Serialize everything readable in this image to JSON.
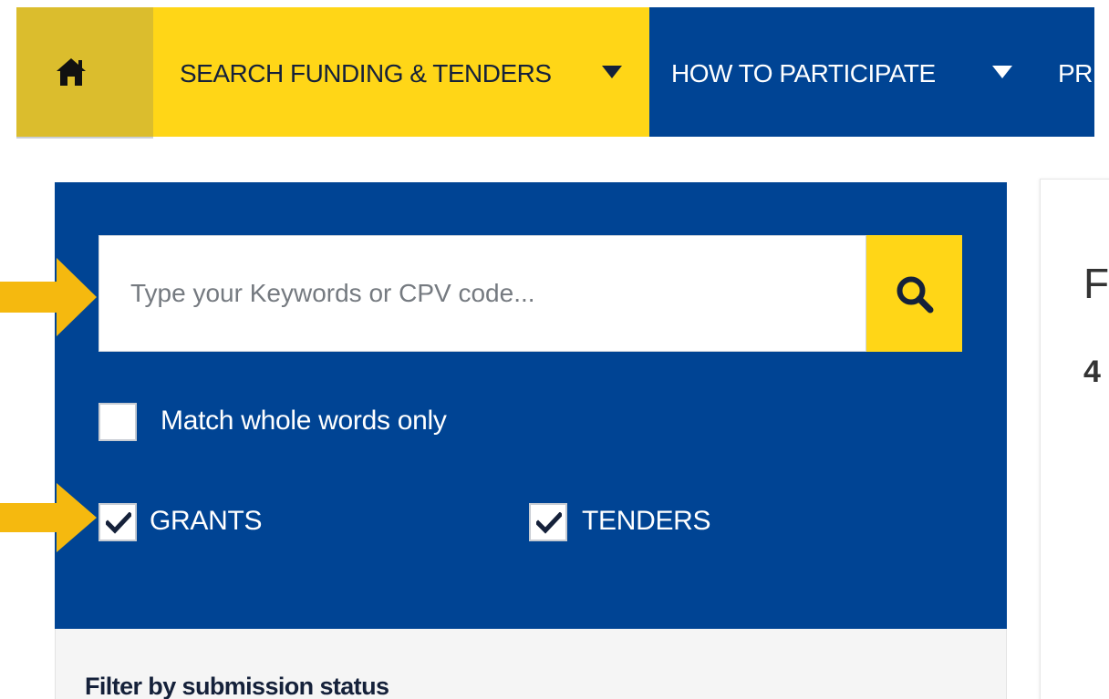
{
  "nav": {
    "search_label": "SEARCH FUNDING & TENDERS",
    "how_label": "HOW TO PARTICIPATE",
    "next_partial_label": "PR"
  },
  "search": {
    "placeholder": "Type your Keywords or CPV code...",
    "value": ""
  },
  "options": {
    "match_whole_words": {
      "label": "Match whole words only",
      "checked": false
    },
    "grants": {
      "label": "GRANTS",
      "checked": true
    },
    "tenders": {
      "label": "TENDERS",
      "checked": true
    }
  },
  "filter": {
    "title": "Filter by submission status"
  },
  "results": {
    "heading_partial": "F",
    "count_partial": "4"
  },
  "icons": {
    "home": "home-icon",
    "search": "search-icon",
    "caret": "caret-down-icon",
    "check": "check-icon",
    "arrow": "arrow-right-icon"
  },
  "colors": {
    "brand_blue": "#004494",
    "accent_yellow": "#ffd617",
    "home_tab_yellow": "#dbbd2d",
    "arrow_yellow": "#f5b90f",
    "dark_text": "#15213a"
  }
}
